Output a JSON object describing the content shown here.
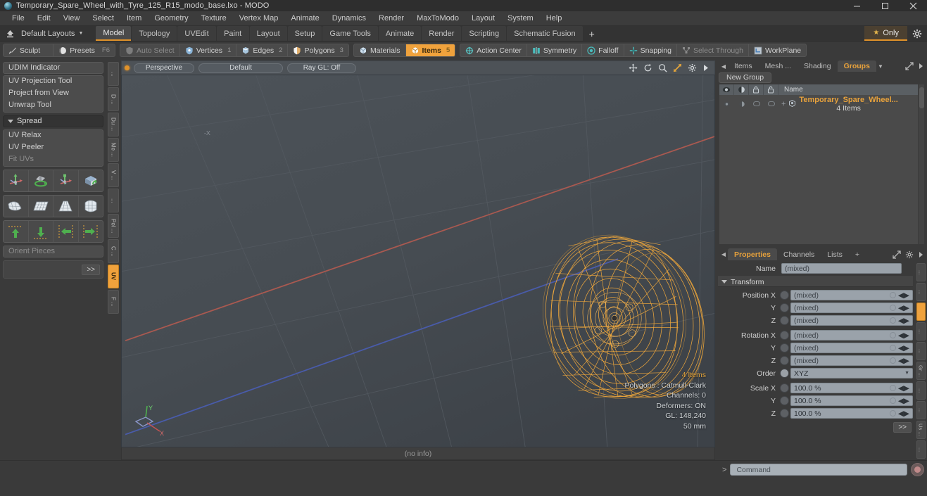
{
  "titlebar": {
    "title": "Temporary_Spare_Wheel_with_Tyre_125_R15_modo_base.lxo - MODO",
    "minimize": "minimize-icon",
    "maximize": "maximize-icon",
    "close": "close-icon"
  },
  "menu": {
    "items": [
      "File",
      "Edit",
      "View",
      "Select",
      "Item",
      "Geometry",
      "Texture",
      "Vertex Map",
      "Animate",
      "Dynamics",
      "Render",
      "MaxToModo",
      "Layout",
      "System",
      "Help"
    ]
  },
  "layoutbar": {
    "home_icon": "home-icon",
    "layout_select": "Default Layouts",
    "tabs": [
      {
        "label": "Model",
        "selected": true
      },
      {
        "label": "Topology",
        "selected": false
      },
      {
        "label": "UVEdit",
        "selected": false
      },
      {
        "label": "Paint",
        "selected": false
      },
      {
        "label": "Layout",
        "selected": false
      },
      {
        "label": "Setup",
        "selected": false
      },
      {
        "label": "Game Tools",
        "selected": false
      },
      {
        "label": "Animate",
        "selected": false
      },
      {
        "label": "Render",
        "selected": false
      },
      {
        "label": "Scripting",
        "selected": false
      },
      {
        "label": "Schematic Fusion",
        "selected": false
      }
    ],
    "add_tab": "+",
    "only_label": "Only",
    "gear_icon": "gear-icon"
  },
  "modebar": {
    "left_group": [
      {
        "label": "Sculpt",
        "icon": "brush-icon",
        "shortcut": "",
        "dim": false,
        "active": false
      },
      {
        "label": "Presets",
        "icon": "sphere-icon",
        "shortcut": "F6",
        "dim": false,
        "active": false
      }
    ],
    "right_group": [
      {
        "label": "Auto Select",
        "icon": "shield-icon",
        "num": "",
        "dim": true,
        "active": false
      },
      {
        "label": "Vertices",
        "icon": "vertex-icon",
        "num": "1",
        "dim": false,
        "active": false
      },
      {
        "label": "Edges",
        "icon": "edge-icon",
        "num": "2",
        "dim": false,
        "active": false
      },
      {
        "label": "Polygons",
        "icon": "polygon-icon",
        "num": "3",
        "dim": false,
        "active": false
      }
    ],
    "group3": [
      {
        "label": "Materials",
        "icon": "material-icon",
        "num": "",
        "dim": false,
        "active": false
      },
      {
        "label": "Items",
        "icon": "items-icon",
        "num": "5",
        "dim": false,
        "active": true
      }
    ],
    "group4": [
      {
        "label": "Action Center",
        "icon": "action-center-icon",
        "dim": false
      },
      {
        "label": "Symmetry",
        "icon": "symmetry-icon",
        "dim": false
      },
      {
        "label": "Falloff",
        "icon": "falloff-icon",
        "dim": false
      },
      {
        "label": "Snapping",
        "icon": "snapping-icon",
        "dim": false
      },
      {
        "label": "Select Through",
        "icon": "select-through-icon",
        "dim": true
      },
      {
        "label": "WorkPlane",
        "icon": "workplane-icon",
        "dim": false
      }
    ]
  },
  "leftpanel": {
    "udim": "UDIM Indicator",
    "tools_group1": [
      "UV Projection Tool",
      "Project from View",
      "Unwrap Tool"
    ],
    "spread_header": "Spread",
    "tools_group2": [
      "UV Relax",
      "UV Peeler"
    ],
    "tools_group2_dim": "Fit UVs",
    "icon_row1": [
      "uv-move-icon",
      "uv-rotate-icon",
      "uv-scale-icon",
      "uv-flip-icon"
    ],
    "icon_row2": [
      "uv-fit-icon",
      "uv-grid-icon",
      "uv-taper-icon",
      "uv-sphere-icon"
    ],
    "icon_row3": [
      "align-up-icon",
      "align-down-icon",
      "align-left-icon",
      "align-right-icon"
    ],
    "orient_pieces": "Orient Pieces",
    "more_button": ">>",
    "vtabs": [
      {
        "label": "...",
        "selected": false
      },
      {
        "label": "D ...",
        "selected": false
      },
      {
        "label": "Du ...",
        "selected": false
      },
      {
        "label": "Me ...",
        "selected": false
      },
      {
        "label": "V ...",
        "selected": false
      },
      {
        "label": "...",
        "selected": false
      },
      {
        "label": "Pol ...",
        "selected": false
      },
      {
        "label": "C ...",
        "selected": false
      },
      {
        "label": "UV",
        "selected": true
      },
      {
        "label": "F ...",
        "selected": false
      }
    ]
  },
  "viewport": {
    "header": {
      "view_mode": "Perspective",
      "shading": "Default",
      "raygl": "Ray GL: Off",
      "icons": [
        "move-icon",
        "rotate-icon",
        "zoom-icon",
        "fit-icon",
        "gear-icon",
        "chevron-right-icon"
      ]
    },
    "info": {
      "items_count": "4 Items",
      "polygons": "Polygons : Catmull-Clark",
      "channels": "Channels: 0",
      "deformers": "Deformers: ON",
      "gl": "GL: 148,240",
      "scale": "50 mm"
    },
    "axis_labels": {
      "x": "X",
      "y": "Y",
      "neg_x": "-X"
    },
    "footer": "(no info)",
    "mesh_color": "#f0a83c"
  },
  "rightpanel": {
    "top_tabs": [
      {
        "label": "Items",
        "selected": false
      },
      {
        "label": "Mesh ...",
        "selected": false
      },
      {
        "label": "Shading",
        "selected": false
      },
      {
        "label": "Groups",
        "selected": true
      }
    ],
    "top_tabs_caret": "chevron-down-icon",
    "expand_icon": "expand-icon",
    "chevron_icon": "chevron-right-icon",
    "new_group_button": "New Group",
    "list_header": {
      "col_eye": "visibility-icon",
      "col_render": "render-icon",
      "col_lock1": "lock-icon",
      "col_lock2": "lock-alt-icon",
      "name": "Name"
    },
    "items": [
      {
        "name": "Temporary_Spare_Wheel...",
        "sub": "4 Items",
        "icon": "group-icon"
      }
    ],
    "props_tabs": [
      {
        "label": "Properties",
        "selected": true
      },
      {
        "label": "Channels",
        "selected": false
      },
      {
        "label": "Lists",
        "selected": false
      },
      {
        "label": "+",
        "selected": false
      }
    ],
    "props_gear": "gear-icon",
    "properties": {
      "name_label": "Name",
      "name_value": "(mixed)",
      "transform_header": "Transform",
      "rows": [
        {
          "label": "Position X",
          "value": "(mixed)",
          "type": "field"
        },
        {
          "label": "Y",
          "value": "(mixed)",
          "type": "field"
        },
        {
          "label": "Z",
          "value": "(mixed)",
          "type": "field"
        },
        {
          "label": "Rotation X",
          "value": "(mixed)",
          "type": "field"
        },
        {
          "label": "Y",
          "value": "(mixed)",
          "type": "field"
        },
        {
          "label": "Z",
          "value": "(mixed)",
          "type": "field"
        },
        {
          "label": "Order",
          "value": "XYZ",
          "type": "dropdown"
        },
        {
          "label": "Scale X",
          "value": "100.0 %",
          "type": "field"
        },
        {
          "label": "Y",
          "value": "100.0 %",
          "type": "field"
        },
        {
          "label": "Z",
          "value": "100.0 %",
          "type": "field"
        }
      ],
      "more_button": ">>"
    },
    "vtabs": [
      {
        "label": "...",
        "selected": false
      },
      {
        "label": "...",
        "selected": false
      },
      {
        "label": "...",
        "selected": true
      },
      {
        "label": "...",
        "selected": false
      },
      {
        "label": "...",
        "selected": false
      },
      {
        "label": "Gr ...",
        "selected": false
      },
      {
        "label": "...",
        "selected": false
      },
      {
        "label": "...",
        "selected": false
      },
      {
        "label": "Us ...",
        "selected": false
      },
      {
        "label": "...",
        "selected": false
      }
    ]
  },
  "bottombar": {
    "command_arrow": ">",
    "command_placeholder": "Command",
    "record_icon": "record-icon"
  },
  "colors": {
    "accent": "#f0a23c",
    "panel": "#3a3a3a",
    "mesh": "#f0a83c"
  }
}
